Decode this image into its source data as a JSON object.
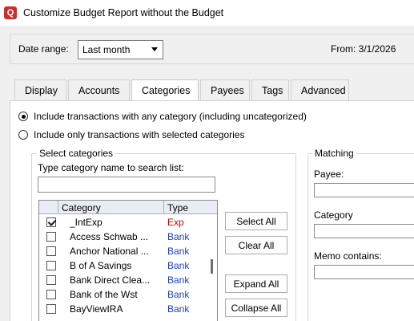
{
  "window": {
    "title": "Customize Budget Report without the Budget",
    "app_icon_glyph": "Q"
  },
  "toolbar": {
    "date_range_label": "Date range:",
    "date_range_value": "Last month",
    "from_label": "From: 3/1/2026"
  },
  "tabs": [
    {
      "label": "Display",
      "active": false
    },
    {
      "label": "Accounts",
      "active": false
    },
    {
      "label": "Categories",
      "active": true
    },
    {
      "label": "Payees",
      "active": false
    },
    {
      "label": "Tags",
      "active": false
    },
    {
      "label": "Advanced",
      "active": false
    }
  ],
  "categories_tab": {
    "radio_any_label": "Include transactions with any category (including uncategorized)",
    "radio_selected_label": "Include only transactions with selected categories",
    "select_group_title": "Select categories",
    "search_hint": "Type category name to search list:",
    "search_value": "",
    "grid": {
      "col_category": "Category",
      "col_type": "Type",
      "rows": [
        {
          "name": "_IntExp",
          "type": "Exp",
          "checked": true
        },
        {
          "name": "Access Schwab ...",
          "type": "Bank",
          "checked": false
        },
        {
          "name": "Anchor National ...",
          "type": "Bank",
          "checked": false
        },
        {
          "name": "B of A Savings",
          "type": "Bank",
          "checked": false
        },
        {
          "name": "Bank Direct Clea...",
          "type": "Bank",
          "checked": false
        },
        {
          "name": "Bank of the Wst",
          "type": "Bank",
          "checked": false
        },
        {
          "name": "BayViewIRA",
          "type": "Bank",
          "checked": false
        }
      ]
    },
    "buttons": {
      "select_all": "Select All",
      "clear_all": "Clear All",
      "expand_all": "Expand All",
      "collapse_all": "Collapse All"
    },
    "matching": {
      "title": "Matching",
      "payee_label": "Payee:",
      "payee_value": "",
      "category_label": "Category",
      "category_value": "",
      "memo_label": "Memo contains:",
      "memo_value": ""
    }
  },
  "colors": {
    "type_exp": "#d00000",
    "type_bank": "#1a3fc8",
    "app_icon": "#d22b2b"
  }
}
